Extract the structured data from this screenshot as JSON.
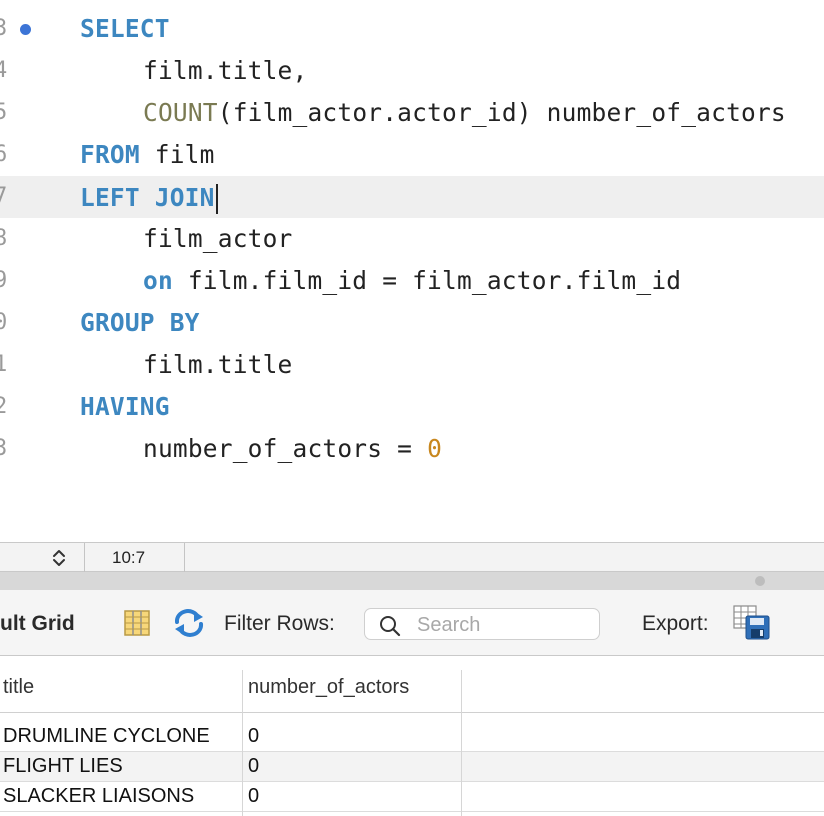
{
  "editor": {
    "lines": [
      {
        "num": "3",
        "breakpoint": true,
        "current": false,
        "indent": 0,
        "tokens": [
          {
            "t": "SELECT",
            "c": "kw"
          }
        ]
      },
      {
        "num": "4",
        "breakpoint": false,
        "current": false,
        "indent": 1,
        "tokens": [
          {
            "t": "film.title,",
            "c": ""
          }
        ]
      },
      {
        "num": "5",
        "breakpoint": false,
        "current": false,
        "indent": 1,
        "tokens": [
          {
            "t": "COUNT",
            "c": "fn"
          },
          {
            "t": "(film_actor.actor_id) number_of_actors",
            "c": ""
          }
        ]
      },
      {
        "num": "6",
        "breakpoint": false,
        "current": false,
        "indent": 0,
        "tokens": [
          {
            "t": "FROM",
            "c": "kw"
          },
          {
            "t": " film",
            "c": ""
          }
        ]
      },
      {
        "num": "7",
        "breakpoint": false,
        "current": true,
        "indent": 0,
        "tokens": [
          {
            "t": "LEFT JOIN",
            "c": "kw"
          }
        ],
        "caret": true
      },
      {
        "num": "8",
        "breakpoint": false,
        "current": false,
        "indent": 1,
        "tokens": [
          {
            "t": "film_actor",
            "c": ""
          }
        ]
      },
      {
        "num": "9",
        "breakpoint": false,
        "current": false,
        "indent": 1,
        "tokens": [
          {
            "t": "on",
            "c": "kw2"
          },
          {
            "t": " film.film_id = film_actor.film_id",
            "c": ""
          }
        ]
      },
      {
        "num": "0",
        "breakpoint": false,
        "current": false,
        "indent": 0,
        "tokens": [
          {
            "t": "GROUP BY",
            "c": "kw"
          }
        ]
      },
      {
        "num": "1",
        "breakpoint": false,
        "current": false,
        "indent": 1,
        "tokens": [
          {
            "t": "film.title",
            "c": ""
          }
        ]
      },
      {
        "num": "2",
        "breakpoint": false,
        "current": false,
        "indent": 0,
        "tokens": [
          {
            "t": "HAVING",
            "c": "kw"
          }
        ]
      },
      {
        "num": "3",
        "breakpoint": false,
        "current": false,
        "indent": 1,
        "tokens": [
          {
            "t": "number_of_actors = ",
            "c": ""
          },
          {
            "t": "0",
            "c": "num"
          }
        ]
      }
    ]
  },
  "status": {
    "cursor_position": "10:7"
  },
  "toolbar": {
    "tab_label": "ult Grid",
    "filter_label": "Filter Rows:",
    "search_placeholder": "Search",
    "search_value": "",
    "export_label": "Export:",
    "icons": [
      "grid-view-icon",
      "refresh-icon",
      "search-icon",
      "export-save-icon"
    ]
  },
  "result_grid": {
    "columns": [
      "title",
      "number_of_actors"
    ],
    "rows": [
      [
        "DRUMLINE CYCLONE",
        "0"
      ],
      [
        "FLIGHT LIES",
        "0"
      ],
      [
        "SLACKER LIAISONS",
        "0"
      ]
    ]
  },
  "colors": {
    "keyword": "#3d87c0",
    "number": "#c8871e",
    "function": "#7a7a52",
    "breakpoint": "#3c74d6",
    "current_line": "#efefef"
  }
}
